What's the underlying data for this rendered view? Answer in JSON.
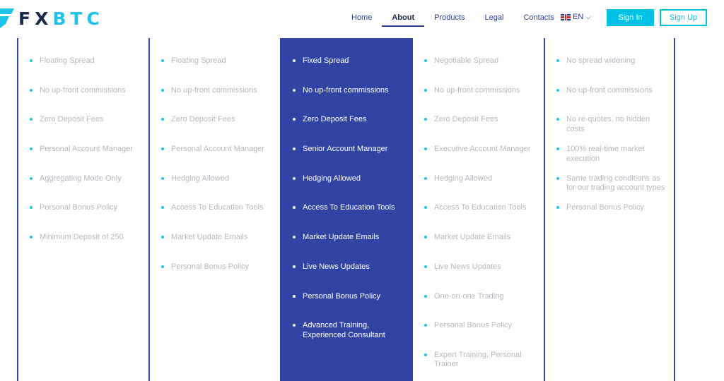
{
  "header": {
    "logo": {
      "part1": "FX",
      "part2": "BTC"
    },
    "nav": [
      {
        "label": "Home",
        "active": false
      },
      {
        "label": "About",
        "active": true
      },
      {
        "label": "Products",
        "active": false
      },
      {
        "label": "Legal",
        "active": false
      },
      {
        "label": "Contacts",
        "active": false
      }
    ],
    "language": {
      "icon": "uk-flag-icon",
      "label": "EN",
      "chevron": "⌵"
    },
    "sign_in": "Sign In",
    "sign_up": "Sign Up"
  },
  "colors": {
    "brand_dark": "#1b2a4a",
    "brand_cyan": "#1fc3ea",
    "accent_blue": "#3144a3",
    "button_cyan": "#00c2e6",
    "feature_text": "#b4b8be"
  },
  "plans": [
    {
      "featured": false,
      "features": [
        "Floating Spread",
        "No up-front commissions",
        "Zero Deposit Fees",
        "Personal Account Manager",
        "Aggregating Mode Only",
        "Personal Bonus Policy",
        "Minimum Deposit of 250"
      ]
    },
    {
      "featured": false,
      "features": [
        "Floating Spread",
        "No up-front commissions",
        "Zero Deposit Fees",
        "Personal Account Manager",
        "Hedging Allowed",
        "Access To Education Tools",
        "Market Update Emails",
        "Personal Bonus Policy"
      ]
    },
    {
      "featured": true,
      "features": [
        "Fixed Spread",
        "No up-front commissions",
        "Zero Deposit Fees",
        "Senior Account Manager",
        "Hedging Allowed",
        "Access To Education Tools",
        "Market Update Emails",
        "Live News Updates",
        "Personal Bonus Policy",
        "Advanced Training, Experienced Consultant"
      ]
    },
    {
      "featured": false,
      "features": [
        "Negotiable Spread",
        "No up-front commissions",
        "Zero Deposit Fees",
        "Executive Account Manager",
        "Hedging Allowed",
        "Access To Education Tools",
        "Market Update Emails",
        "Live News Updates",
        "One-on-one Trading",
        "Personal Bonus Policy",
        "Expert Training, Personal Trainer"
      ]
    },
    {
      "featured": false,
      "features": [
        "No spread widening",
        "No up-front commissions",
        "No re-quotes, no hidden costs",
        "100% real-time market execution",
        "Same trading conditions as for our trading account types",
        "Personal Bonus Policy"
      ]
    }
  ]
}
